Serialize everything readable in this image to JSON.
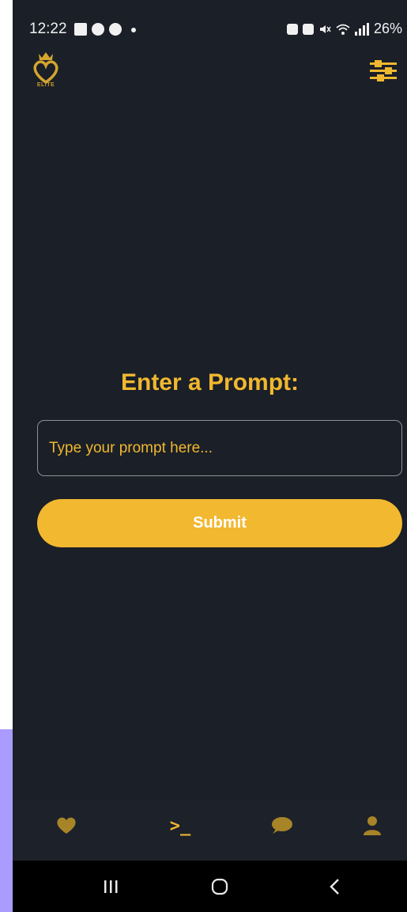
{
  "status_bar": {
    "time": "12:22",
    "battery": "26%"
  },
  "header": {
    "logo_text": "ELITE",
    "logo_icon": "crown-heart-icon",
    "filter_icon": "sliders-icon"
  },
  "main": {
    "title": "Enter a Prompt:",
    "input_placeholder": "Type your prompt here...",
    "input_value": "",
    "submit_label": "Submit"
  },
  "tab_bar": {
    "items": [
      {
        "icon": "heart-icon"
      },
      {
        "icon": "terminal-icon",
        "glyph": ">_"
      },
      {
        "icon": "chat-bubble-icon"
      },
      {
        "icon": "user-icon"
      }
    ]
  },
  "colors": {
    "background": "#1b1f27",
    "accent": "#f2b830",
    "tab_icon_inactive": "#a88428",
    "input_border": "#8d919a",
    "nav_bar": "#000000"
  }
}
